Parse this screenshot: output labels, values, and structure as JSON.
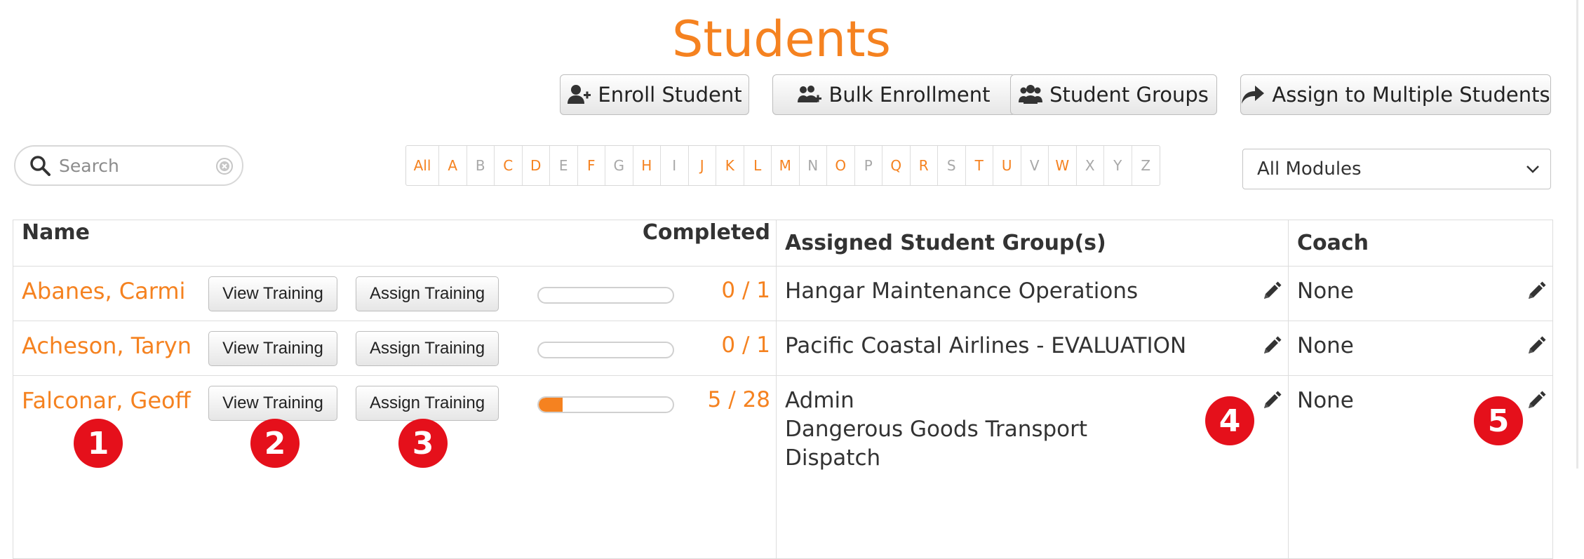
{
  "page": {
    "title": "Students"
  },
  "toolbar": {
    "enroll_label": "Enroll Student",
    "bulk_label": "Bulk Enrollment",
    "groups_label": "Student Groups",
    "assign_multi_label": "Assign to Multiple Students"
  },
  "search": {
    "placeholder": "Search",
    "value": ""
  },
  "alphabet": {
    "items": [
      {
        "label": "All",
        "enabled": true
      },
      {
        "label": "A",
        "enabled": true
      },
      {
        "label": "B",
        "enabled": false
      },
      {
        "label": "C",
        "enabled": true
      },
      {
        "label": "D",
        "enabled": true
      },
      {
        "label": "E",
        "enabled": false
      },
      {
        "label": "F",
        "enabled": true
      },
      {
        "label": "G",
        "enabled": false
      },
      {
        "label": "H",
        "enabled": true
      },
      {
        "label": "I",
        "enabled": false
      },
      {
        "label": "J",
        "enabled": true
      },
      {
        "label": "K",
        "enabled": true
      },
      {
        "label": "L",
        "enabled": true
      },
      {
        "label": "M",
        "enabled": true
      },
      {
        "label": "N",
        "enabled": false
      },
      {
        "label": "O",
        "enabled": true
      },
      {
        "label": "P",
        "enabled": false
      },
      {
        "label": "Q",
        "enabled": true
      },
      {
        "label": "R",
        "enabled": true
      },
      {
        "label": "S",
        "enabled": false
      },
      {
        "label": "T",
        "enabled": true
      },
      {
        "label": "U",
        "enabled": true
      },
      {
        "label": "V",
        "enabled": false
      },
      {
        "label": "W",
        "enabled": true
      },
      {
        "label": "X",
        "enabled": false
      },
      {
        "label": "Y",
        "enabled": false
      },
      {
        "label": "Z",
        "enabled": false
      }
    ]
  },
  "module_filter": {
    "selected": "All Modules"
  },
  "table": {
    "headers": {
      "name": "Name",
      "completed": "Completed",
      "groups": "Assigned Student Group(s)",
      "coach": "Coach"
    },
    "view_label": "View Training",
    "assign_label": "Assign Training",
    "rows": [
      {
        "name": "Abanes, Carmi",
        "completed": "0 / 1",
        "progress_fraction": 0,
        "groups": [
          "Hangar Maintenance Operations"
        ],
        "coach": "None"
      },
      {
        "name": "Acheson, Taryn",
        "completed": "0 / 1",
        "progress_fraction": 0,
        "groups": [
          "Pacific Coastal Airlines - EVALUATION"
        ],
        "coach": "None"
      },
      {
        "name": "Falconar, Geoff",
        "completed": "5 / 28",
        "progress_fraction": 0.1786,
        "groups": [
          "Admin",
          "Dangerous Goods Transport",
          "Dispatch"
        ],
        "coach": "None"
      }
    ]
  },
  "callouts": [
    "1",
    "2",
    "3",
    "4",
    "5"
  ],
  "colors": {
    "accent": "#f58220",
    "callout": "#e5101b",
    "text": "#333333",
    "disabled_letter": "#a8a8a8"
  },
  "icons": {
    "enroll": "user-plus-icon",
    "bulk": "users-plus-icon",
    "groups": "users-icon",
    "assign_multi": "share-arrow-icon",
    "search": "search-icon",
    "clear": "clear-icon",
    "select": "chevron-down-icon",
    "edit": "pencil-icon"
  }
}
